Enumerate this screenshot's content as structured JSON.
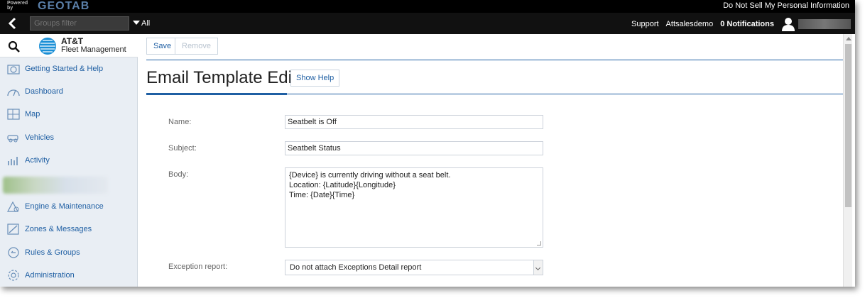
{
  "topbar": {
    "powered_by": "Powered by",
    "brand": "GEOTAB",
    "do_not_sell": "Do Not Sell My Personal Information"
  },
  "navbar": {
    "groups_placeholder": "Groups filter",
    "all_label": "All",
    "support": "Support",
    "account": "Attsalesdemo",
    "notifications": "0 Notifications"
  },
  "sidebar": {
    "brand_name": "AT&T",
    "brand_sub": "Fleet Management",
    "items": [
      {
        "label": "Getting Started & Help",
        "icon": "help-icon"
      },
      {
        "label": "Dashboard",
        "icon": "dashboard-icon"
      },
      {
        "label": "Map",
        "icon": "map-icon"
      },
      {
        "label": "Vehicles",
        "icon": "vehicle-icon"
      },
      {
        "label": "Activity",
        "icon": "activity-icon"
      },
      {
        "label": "Engine & Maintenance",
        "icon": "engine-icon"
      },
      {
        "label": "Zones & Messages",
        "icon": "zones-icon"
      },
      {
        "label": "Rules & Groups",
        "icon": "rules-icon"
      },
      {
        "label": "Administration",
        "icon": "gear-icon"
      }
    ]
  },
  "toolbar": {
    "save_label": "Save",
    "remove_label": "Remove"
  },
  "page": {
    "title": "Email Template Edit",
    "show_help": "Show Help"
  },
  "form": {
    "name_label": "Name:",
    "name_value": "Seatbelt is Off",
    "subject_label": "Subject:",
    "subject_value": "Seatbelt Status",
    "body_label": "Body:",
    "body_value": "{Device} is currently driving without a seat belt.\nLocation: {Latitude}{Longitude}\nTime: {Date}{Time}",
    "exception_label": "Exception report:",
    "exception_value": "Do not attach Exceptions Detail report"
  },
  "colors": {
    "accent": "#1f5fa3",
    "sidebar_bg": "#e9eef4",
    "topbar_bg": "#000000"
  }
}
